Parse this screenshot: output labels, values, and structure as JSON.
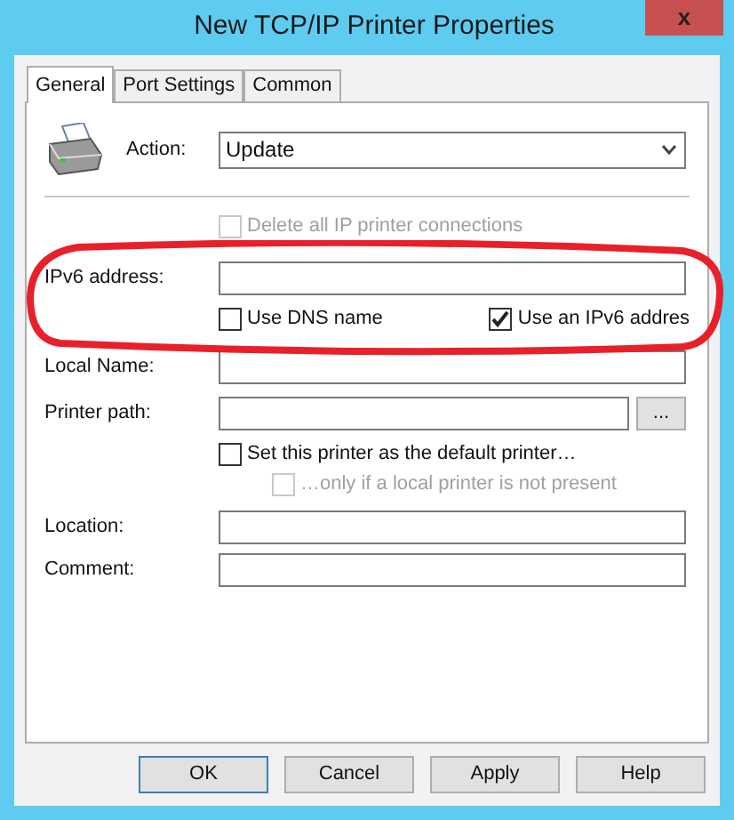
{
  "window": {
    "title": "New TCP/IP Printer Properties",
    "close": "x"
  },
  "tabs": [
    {
      "label": "General",
      "selected": true
    },
    {
      "label": "Port Settings",
      "selected": false
    },
    {
      "label": "Common",
      "selected": false
    }
  ],
  "action": {
    "label": "Action:",
    "value": "Update"
  },
  "delete_all": {
    "label": "Delete all IP printer connections",
    "checked": false,
    "disabled": true
  },
  "ipv6": {
    "label": "IPv6 address:",
    "use_dns": {
      "label": "Use DNS name",
      "checked": false,
      "disabled": false
    },
    "use_ipv6": {
      "label": "Use an IPv6 addres",
      "checked": true,
      "disabled": false
    }
  },
  "local_name": {
    "label": "Local Name:"
  },
  "printer_path": {
    "label": "Printer path:",
    "browse": "..."
  },
  "default_printer": {
    "label": "Set this printer as the default printer…",
    "checked": false,
    "disabled": false
  },
  "only_if_local": {
    "label": "…only if a local printer is not present",
    "checked": false,
    "disabled": true
  },
  "location": {
    "label": "Location:"
  },
  "comment": {
    "label": "Comment:"
  },
  "buttons": [
    {
      "label": "OK",
      "selected": true
    },
    {
      "label": "Cancel",
      "selected": false
    },
    {
      "label": "Apply",
      "selected": false
    },
    {
      "label": "Help",
      "selected": false
    }
  ]
}
